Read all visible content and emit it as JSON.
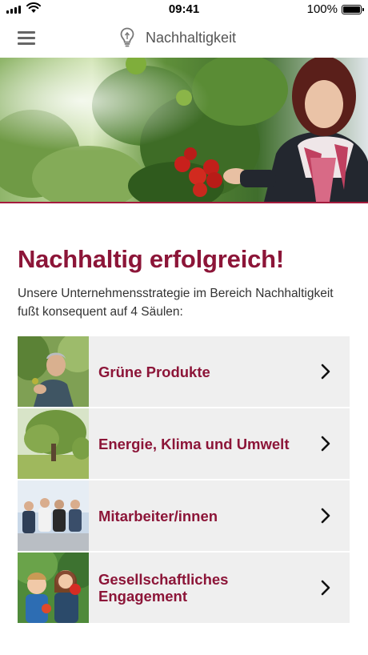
{
  "status_bar": {
    "time": "09:41",
    "battery_percent": "100%"
  },
  "nav": {
    "title": "Nachhaltigkeit",
    "menu_icon": "hamburger-menu-icon",
    "logo_icon": "lightbulb-icon"
  },
  "hero": {
    "description_icon": "hero-image"
  },
  "main": {
    "headline": "Nachhaltig erfolgreich!",
    "intro": "Unsere Unternehmensstrategie im Bereich Nachhaltigkeit fußt konsequent auf 4 Säulen:"
  },
  "pillars": [
    {
      "label": "Grüne Produkte"
    },
    {
      "label": "Energie, Klima und Umwelt"
    },
    {
      "label": "Mitarbeiter/innen"
    },
    {
      "label": "Gesellschaftliches Engagement"
    }
  ],
  "colors": {
    "accent": "#8c1538",
    "hero_border": "#a41b3d",
    "card_bg": "#efefef"
  }
}
